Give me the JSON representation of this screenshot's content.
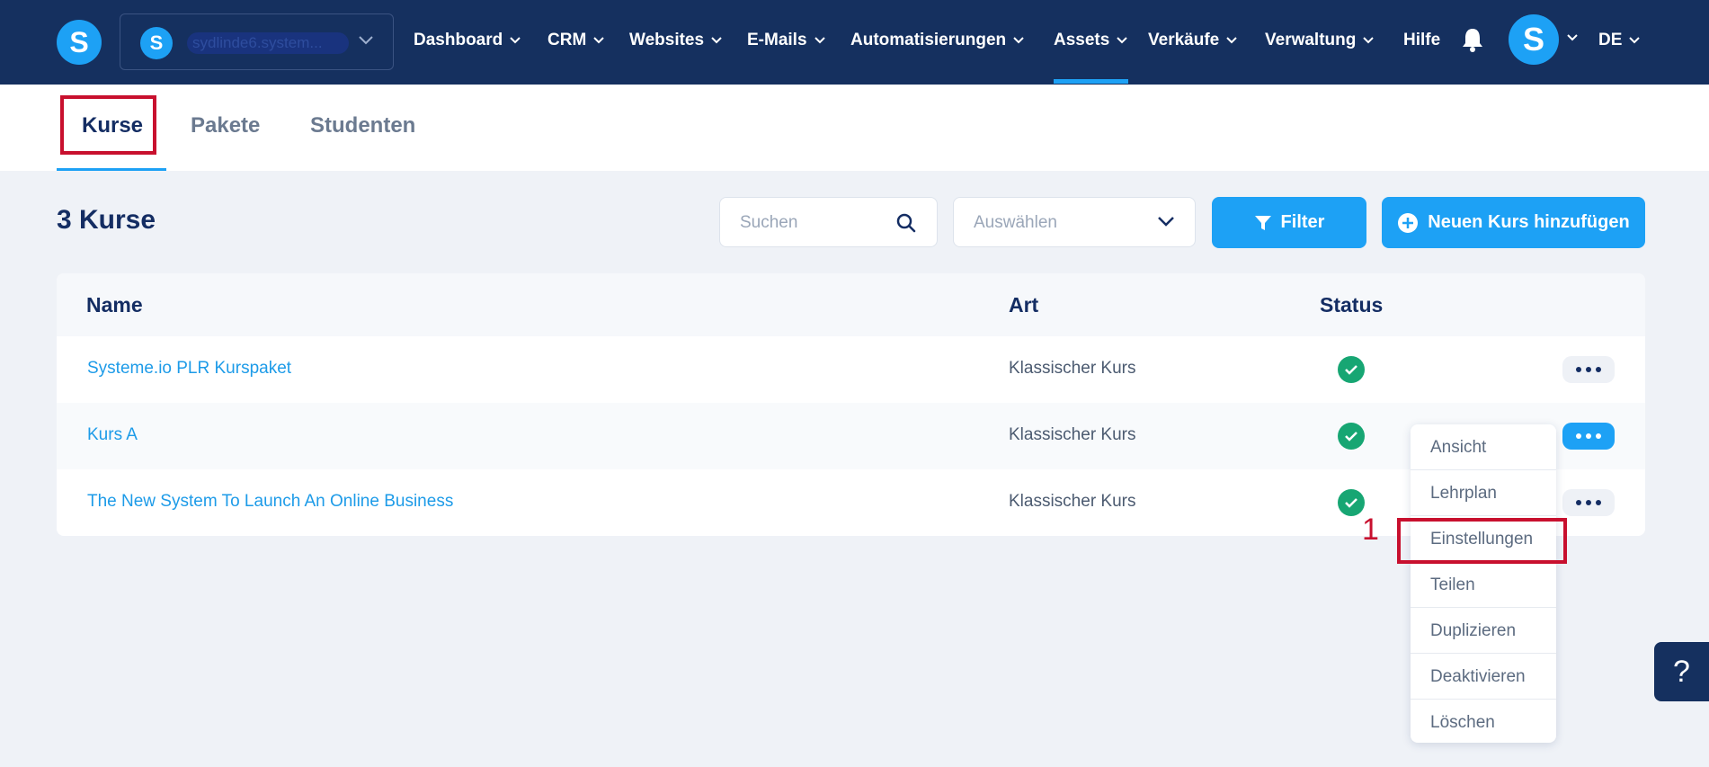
{
  "nav": {
    "logo_letter": "S",
    "workspace": {
      "logo_letter": "S",
      "name": "sydlinde6.system..."
    },
    "items": [
      {
        "label": "Dashboard"
      },
      {
        "label": "CRM"
      },
      {
        "label": "Websites"
      },
      {
        "label": "E-Mails"
      },
      {
        "label": "Automatisierungen"
      },
      {
        "label": "Assets",
        "active": true
      },
      {
        "label": "Verkäufe"
      },
      {
        "label": "Verwaltung"
      }
    ],
    "help_label": "Hilfe",
    "avatar_letter": "S",
    "language": "DE"
  },
  "tabs": [
    {
      "label": "Kurse",
      "active": true
    },
    {
      "label": "Pakete"
    },
    {
      "label": "Studenten"
    }
  ],
  "toolbar": {
    "title": "3 Kurse",
    "search_placeholder": "Suchen",
    "select_placeholder": "Auswählen",
    "filter_label": "Filter",
    "add_label": "Neuen Kurs hinzufügen"
  },
  "table": {
    "headers": {
      "name": "Name",
      "art": "Art",
      "status": "Status"
    },
    "rows": [
      {
        "name": "Systeme.io PLR Kurspaket",
        "art": "Klassischer Kurs",
        "status": "active"
      },
      {
        "name": "Kurs A",
        "art": "Klassischer Kurs",
        "status": "active"
      },
      {
        "name": "The New System To Launch An Online Business",
        "art": "Klassischer Kurs",
        "status": "active"
      }
    ]
  },
  "dropdown_menu": {
    "items": [
      {
        "label": "Ansicht"
      },
      {
        "label": "Lehrplan"
      },
      {
        "label": "Einstellungen"
      },
      {
        "label": "Teilen"
      },
      {
        "label": "Duplizieren"
      },
      {
        "label": "Deaktivieren"
      },
      {
        "label": "Löschen"
      }
    ]
  },
  "annotation": {
    "number": "1"
  },
  "help_button": "?",
  "colors": {
    "nav_bg": "#15305f",
    "accent": "#1da1f5",
    "status_green": "#17a673",
    "annotation_red": "#c8102e"
  }
}
